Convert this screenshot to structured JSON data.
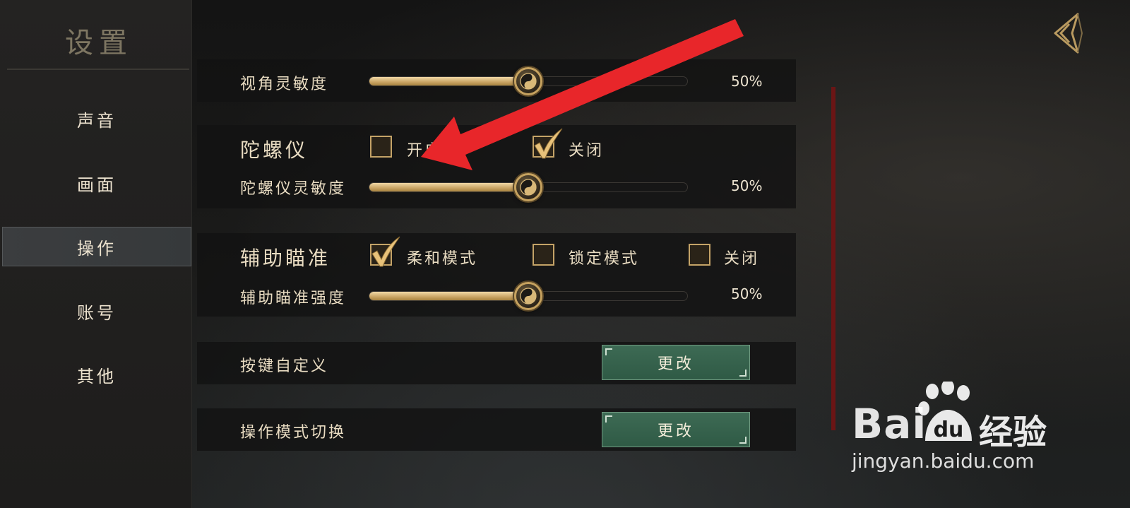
{
  "sidebar": {
    "title": "设置",
    "items": [
      {
        "label": "声音",
        "active": false
      },
      {
        "label": "画面",
        "active": false
      },
      {
        "label": "操作",
        "active": true
      },
      {
        "label": "账号",
        "active": false
      },
      {
        "label": "其他",
        "active": false
      }
    ]
  },
  "camera": {
    "label": "视角灵敏度",
    "value_text": "50%",
    "value": 0.5
  },
  "gyro": {
    "label": "陀螺仪",
    "options": [
      {
        "label": "开启",
        "checked": false
      },
      {
        "label": "关闭",
        "checked": true
      }
    ],
    "sensitivity_label": "陀螺仪灵敏度",
    "sensitivity_text": "50%",
    "sensitivity": 0.5
  },
  "aim": {
    "label": "辅助瞄准",
    "options": [
      {
        "label": "柔和模式",
        "checked": true
      },
      {
        "label": "锁定模式",
        "checked": false
      },
      {
        "label": "关闭",
        "checked": false
      }
    ],
    "strength_label": "辅助瞄准强度",
    "strength_text": "50%",
    "strength": 0.5
  },
  "keybind": {
    "label": "按键自定义",
    "button": "更改"
  },
  "control_mode": {
    "label": "操作模式切换",
    "button": "更改"
  },
  "watermark": {
    "brand": "Bai",
    "paw_text": "du",
    "cn": "经验",
    "url": "jingyan.baidu.com"
  },
  "colors": {
    "accent_gold": "#c9a464",
    "button_green": "#356049",
    "scrollbar_red": "#6b1515",
    "annotation_red": "#e8262a"
  },
  "icons": {
    "back": "back-arrow-icon",
    "knob": "yin-yang-icon",
    "check": "checkmark-icon"
  }
}
